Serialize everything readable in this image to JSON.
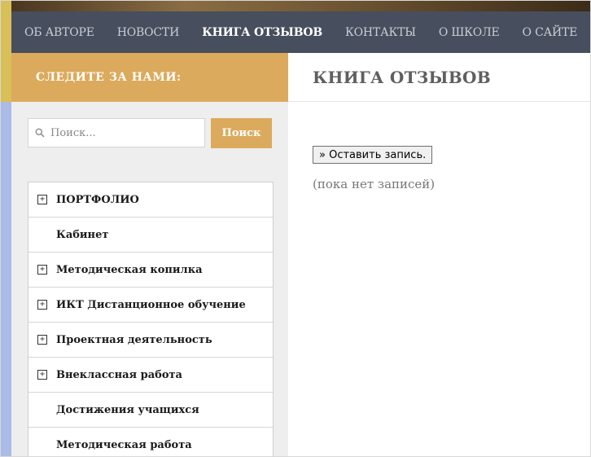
{
  "nav": {
    "items": [
      {
        "label": "ОБ АВТОРЕ",
        "active": false
      },
      {
        "label": "НОВОСТИ",
        "active": false
      },
      {
        "label": "КНИГА ОТЗЫВОВ",
        "active": true
      },
      {
        "label": "КОНТАКТЫ",
        "active": false
      },
      {
        "label": "О ШКОЛЕ",
        "active": false
      },
      {
        "label": "О САЙТЕ",
        "active": false
      }
    ]
  },
  "sidebar": {
    "title": "СЛЕДИТЕ ЗА НАМИ:",
    "search": {
      "placeholder": "Поиск...",
      "value": "",
      "button_label": "Поиск",
      "icon": "search-icon"
    },
    "menu": [
      {
        "label": "ПОРТФОЛИО",
        "expandable": true,
        "toggle": "+"
      },
      {
        "label": "Кабинет",
        "expandable": false
      },
      {
        "label": "Методическая копилка",
        "expandable": true,
        "toggle": "+"
      },
      {
        "label": "ИКТ Дистанционное обучение",
        "expandable": true,
        "toggle": "+"
      },
      {
        "label": "Проектная деятельность",
        "expandable": true,
        "toggle": "+"
      },
      {
        "label": "Внеклассная работа",
        "expandable": true,
        "toggle": "+"
      },
      {
        "label": "Достижения учащихся",
        "expandable": false
      },
      {
        "label": "Методическая работа",
        "expandable": false
      }
    ]
  },
  "main": {
    "title": "КНИГА ОТЗЫВОВ",
    "leave_entry_label": "» Оставить запись.",
    "empty_text": "(пока нет записей)"
  },
  "colors": {
    "navbar": "#474e5d",
    "accent": "#dcaa5c",
    "sidebar_bg": "#eeeeee",
    "left_edge_top": "#d9bf58",
    "left_edge_bottom": "#aabbe8"
  }
}
